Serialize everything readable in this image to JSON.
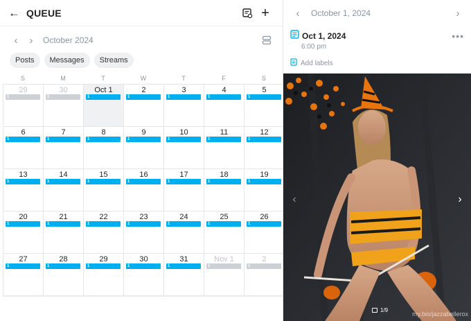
{
  "header": {
    "title": "QUEUE"
  },
  "calendar": {
    "month_label": "October 2024",
    "filters": [
      "Posts",
      "Messages",
      "Streams"
    ],
    "weekdays": [
      "S",
      "M",
      "T",
      "W",
      "T",
      "F",
      "S"
    ],
    "days": [
      {
        "label": "29",
        "count": "1",
        "muted": true
      },
      {
        "label": "30",
        "count": "1",
        "muted": true
      },
      {
        "label": "Oct 1",
        "count": "1",
        "today": true
      },
      {
        "label": "2",
        "count": "1"
      },
      {
        "label": "3",
        "count": "1"
      },
      {
        "label": "4",
        "count": "1"
      },
      {
        "label": "5",
        "count": "1"
      },
      {
        "label": "6",
        "count": "1"
      },
      {
        "label": "7",
        "count": "1"
      },
      {
        "label": "8",
        "count": "1"
      },
      {
        "label": "9",
        "count": "1"
      },
      {
        "label": "10",
        "count": "1"
      },
      {
        "label": "11",
        "count": "1"
      },
      {
        "label": "12",
        "count": "1"
      },
      {
        "label": "13",
        "count": "1"
      },
      {
        "label": "14",
        "count": "1"
      },
      {
        "label": "15",
        "count": "1"
      },
      {
        "label": "16",
        "count": "1"
      },
      {
        "label": "17",
        "count": "1"
      },
      {
        "label": "18",
        "count": "1"
      },
      {
        "label": "19",
        "count": "1"
      },
      {
        "label": "20",
        "count": "1"
      },
      {
        "label": "21",
        "count": "1"
      },
      {
        "label": "22",
        "count": "1"
      },
      {
        "label": "23",
        "count": "1"
      },
      {
        "label": "24",
        "count": "1"
      },
      {
        "label": "25",
        "count": "1"
      },
      {
        "label": "26",
        "count": "1"
      },
      {
        "label": "27",
        "count": "1"
      },
      {
        "label": "28",
        "count": "1"
      },
      {
        "label": "29",
        "count": "1"
      },
      {
        "label": "30",
        "count": "1"
      },
      {
        "label": "31",
        "count": "1"
      },
      {
        "label": "Nov 1",
        "count": "1",
        "muted": true
      },
      {
        "label": "2",
        "count": "1",
        "muted": true
      }
    ]
  },
  "detail": {
    "header_date": "October 1, 2024",
    "post_date": "Oct 1, 2024",
    "post_time": "6:00 pm",
    "add_labels": "Add labels",
    "media_counter": "1/9",
    "watermark": "my.bio/jazzabellerox"
  },
  "colors": {
    "accent": "#00aff0",
    "muted_bar": "#cdd1d5",
    "today_bg": "#f0f1f3"
  },
  "icons": [
    "arrow-left-icon",
    "queue-list-icon",
    "plus-icon",
    "chevron-left-icon",
    "chevron-right-icon",
    "view-toggle-icon",
    "post-icon",
    "more-icon",
    "label-icon",
    "image-count-icon"
  ]
}
